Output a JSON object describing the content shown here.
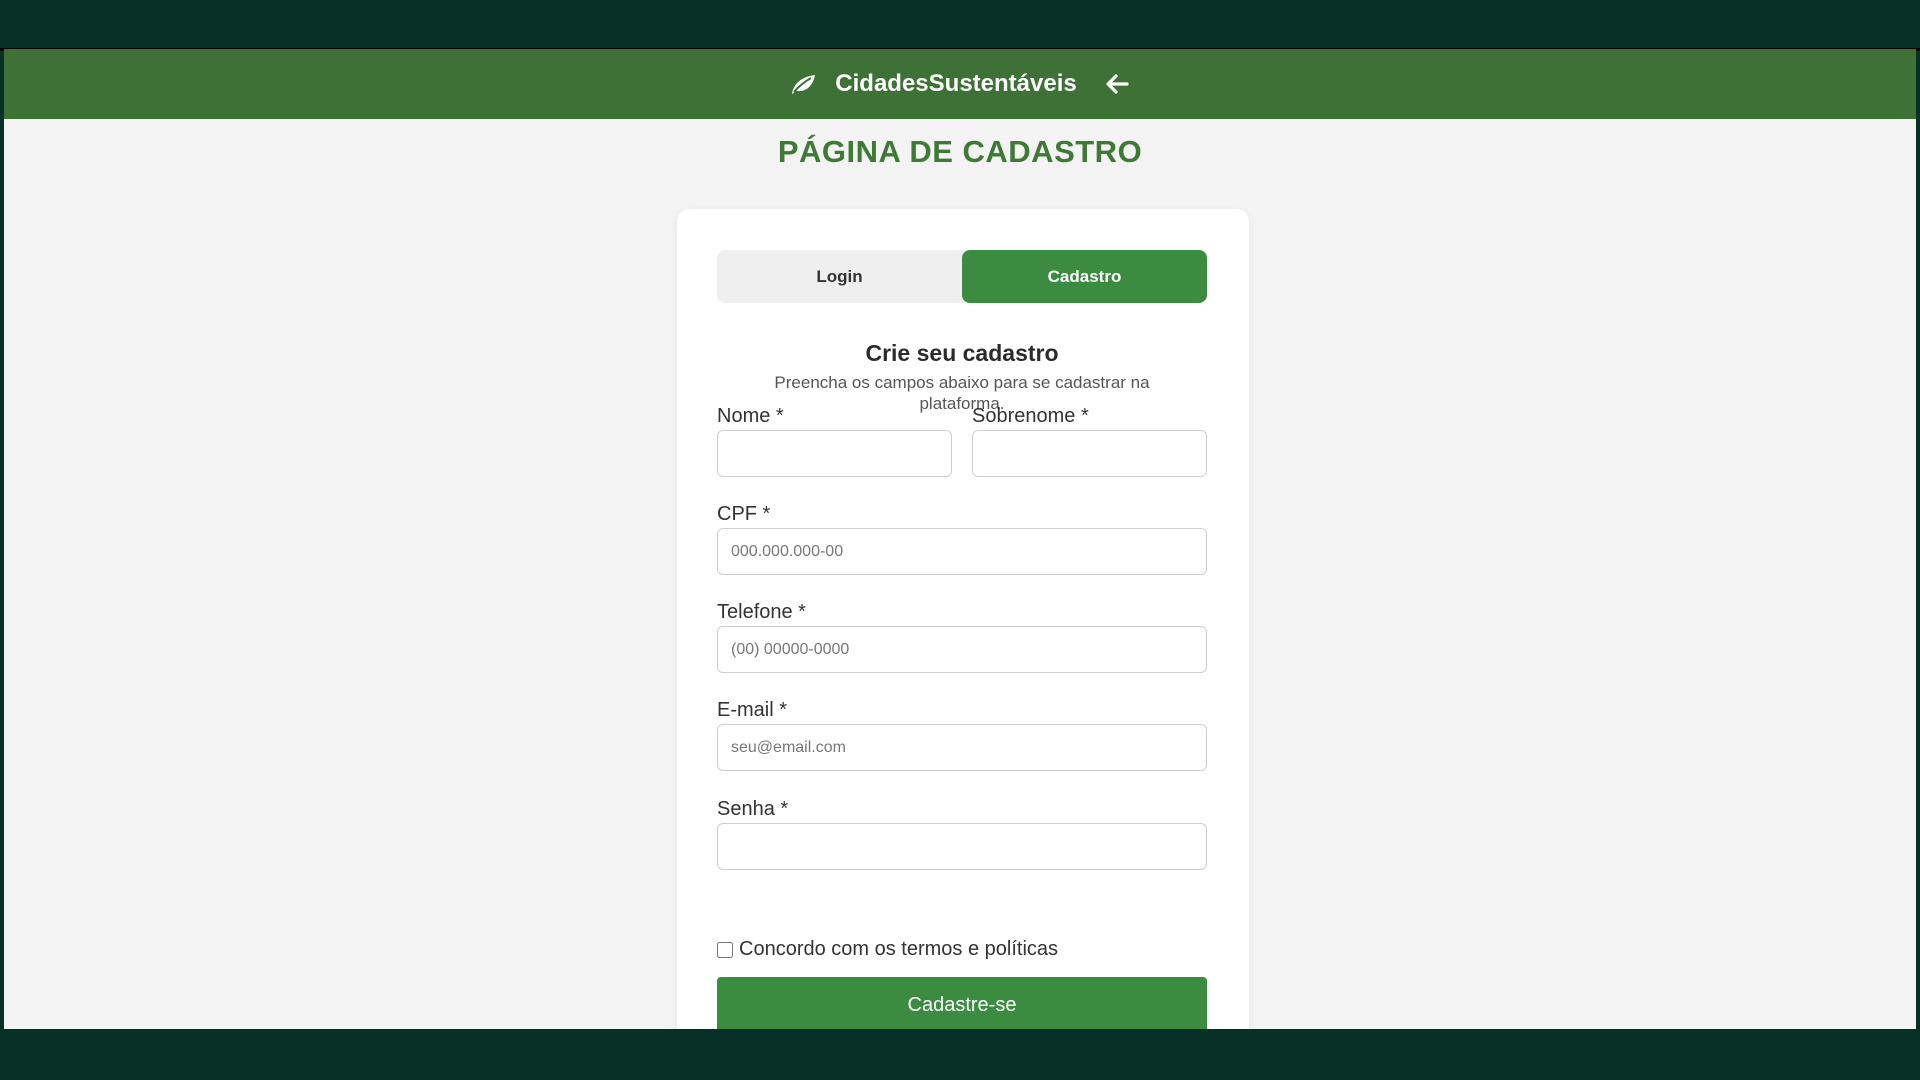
{
  "header": {
    "brand_name": "CidadesSustentáveis",
    "logo_icon": "leaf-icon",
    "back_icon": "arrow-left-icon",
    "color": "#3d7135"
  },
  "page": {
    "title": "PÁGINA DE CADASTRO"
  },
  "tabs": {
    "login_label": "Login",
    "cadastro_label": "Cadastro",
    "active": "Cadastro",
    "active_color": "#3b8b41"
  },
  "form": {
    "heading": "Crie seu cadastro",
    "subheading": "Preencha os campos abaixo para se cadastrar na plataforma.",
    "fields": {
      "nome": {
        "label": "Nome *",
        "value": "",
        "placeholder": ""
      },
      "sobrenome": {
        "label": "Sobrenome *",
        "value": "",
        "placeholder": ""
      },
      "cpf": {
        "label": "CPF *",
        "value": "",
        "placeholder": "000.000.000-00"
      },
      "telefone": {
        "label": "Telefone *",
        "value": "",
        "placeholder": "(00) 00000-0000"
      },
      "email": {
        "label": "E-mail *",
        "value": "",
        "placeholder": "seu@email.com"
      },
      "senha": {
        "label": "Senha *",
        "value": "",
        "placeholder": ""
      }
    },
    "terms_label": "Concordo com os termos e políticas",
    "terms_checked": false,
    "submit_label": "Cadastre-se"
  }
}
